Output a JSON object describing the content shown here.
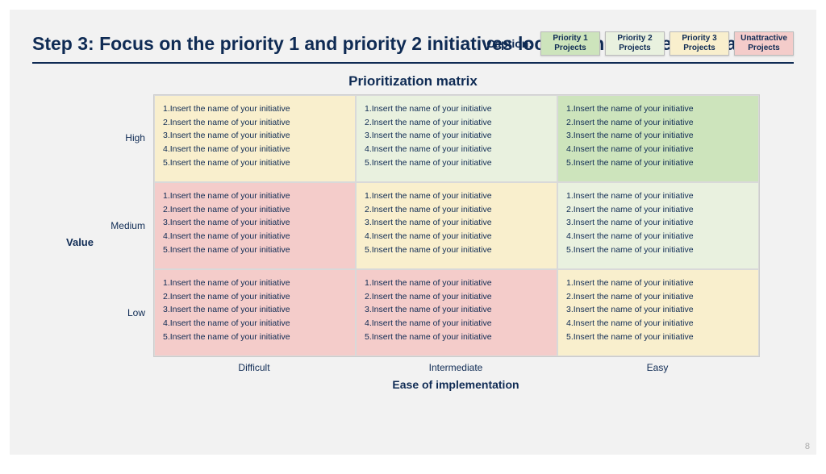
{
  "title": "Step 3: Focus on the priority 1 and priority 2 initiatives located in the green area",
  "caption_label": "Caption:",
  "legend": [
    {
      "line1": "Priority 1",
      "line2": "Projects"
    },
    {
      "line1": "Priority 2",
      "line2": "Projects"
    },
    {
      "line1": "Priority 3",
      "line2": "Projects"
    },
    {
      "line1": "Unattractive",
      "line2": "Projects"
    }
  ],
  "matrix_title": "Prioritization matrix",
  "y_axis": "Value",
  "x_axis": "Ease of implementation",
  "row_labels": [
    "High",
    "Medium",
    "Low"
  ],
  "col_labels": [
    "Difficult",
    "Intermediate",
    "Easy"
  ],
  "cell_items": [
    "1.Insert the name of your initiative",
    "2.Insert the name of your initiative",
    "3.Insert the name of your initiative",
    "4.Insert the name of your initiative",
    "5.Insert the name of your initiative"
  ],
  "page_number": "8",
  "chart_data": {
    "type": "table",
    "title": "Prioritization matrix",
    "xlabel": "Ease of implementation",
    "ylabel": "Value",
    "x_categories": [
      "Difficult",
      "Intermediate",
      "Easy"
    ],
    "y_categories": [
      "High",
      "Medium",
      "Low"
    ],
    "color_map": {
      "green": "Priority 1 Projects",
      "lightgreen": "Priority 2 Projects",
      "yellow": "Priority 3 Projects",
      "pink": "Unattractive Projects"
    },
    "grid_colors": [
      [
        "yellow",
        "lightgreen",
        "green"
      ],
      [
        "pink",
        "yellow",
        "lightgreen"
      ],
      [
        "pink",
        "pink",
        "yellow"
      ]
    ]
  }
}
